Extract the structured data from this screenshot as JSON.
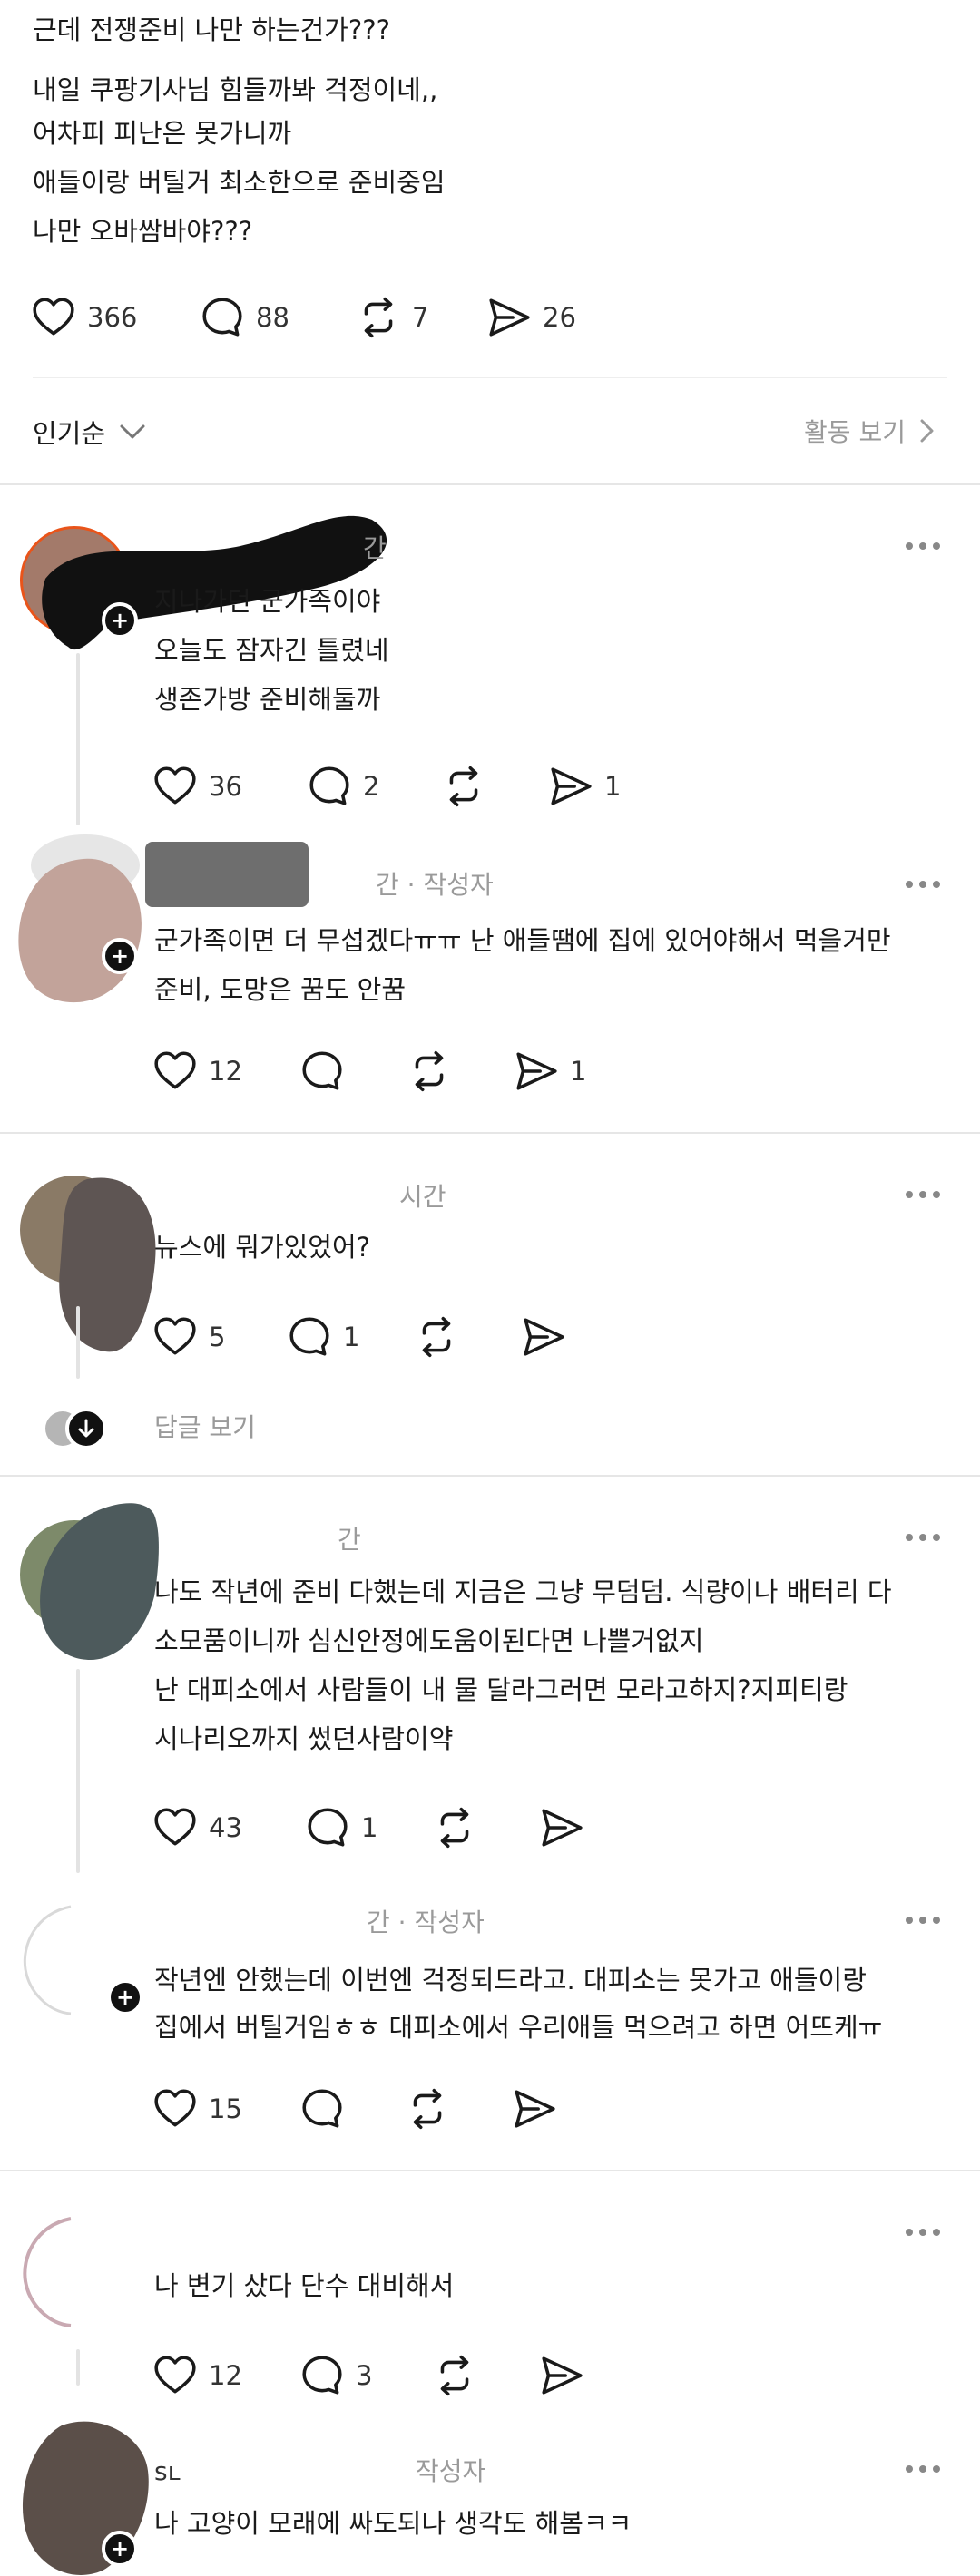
{
  "post": {
    "lines": [
      "근데 전쟁준비 나만 하는건가???",
      "내일 쿠팡기사님 힘들까봐 걱정이네,,",
      "어차피 피난은 못가니까",
      "애들이랑 버틸거 최소한으로 준비중임",
      "나만 오바쌈바야???"
    ],
    "likes": "366",
    "replies": "88",
    "reposts": "7",
    "shares": "26"
  },
  "sort": {
    "label": "인기순",
    "activity_label": "활동 보기"
  },
  "comments": [
    {
      "meta": "간",
      "lines": [
        "지나가던 군가족이야",
        "오늘도 잠자긴 틀렸네",
        "생존가방 준비해둘까"
      ],
      "likes": "36",
      "replies": "2",
      "reposts": "",
      "shares": "1"
    },
    {
      "meta": "간 · 작성자",
      "lines": [
        "군가족이면 더 무섭겠다ㅠㅠ 난 애들땜에 집에 있어야해서 먹을거만",
        "준비, 도망은 꿈도 안꿈"
      ],
      "likes": "12",
      "replies": "",
      "reposts": "",
      "shares": "1"
    },
    {
      "meta": "시간",
      "lines": [
        "뉴스에 뭐가있었어?"
      ],
      "likes": "5",
      "replies": "1",
      "reposts": "",
      "shares": "",
      "view_replies": "답글 보기"
    },
    {
      "meta": "간",
      "lines": [
        "나도 작년에 준비 다했는데 지금은 그냥 무덤덤. 식량이나 배터리 다",
        "소모품이니까 심신안정에도움이된다면 나쁠거없지",
        "난 대피소에서 사람들이 내 물 달라그러면 모라고하지?지피티랑",
        "시나리오까지 썼던사람이약"
      ],
      "likes": "43",
      "replies": "1",
      "reposts": "",
      "shares": ""
    },
    {
      "meta": "간 · 작성자",
      "lines": [
        "작년엔 안했는데 이번엔 걱정되드라고. 대피소는 못가고 애들이랑",
        "집에서 버틸거임ㅎㅎ 대피소에서 우리애들 먹으려고 하면 어뜨케ㅠ"
      ],
      "likes": "15",
      "replies": "",
      "reposts": "",
      "shares": ""
    },
    {
      "meta": "",
      "lines": [
        "나 변기 샀다 단수 대비해서"
      ],
      "likes": "12",
      "replies": "3",
      "reposts": "",
      "shares": ""
    },
    {
      "meta_user": "sʟ",
      "meta": "작성자",
      "lines": [
        "나 고양이 모래에 싸도되나 생각도 해봄ㅋㅋ"
      ]
    }
  ],
  "icons": {
    "like": "heart-icon",
    "reply": "speech-bubble-icon",
    "repost": "repost-icon",
    "share": "send-icon",
    "more": "more-dots-icon",
    "chevron": "chevron-down-icon"
  }
}
